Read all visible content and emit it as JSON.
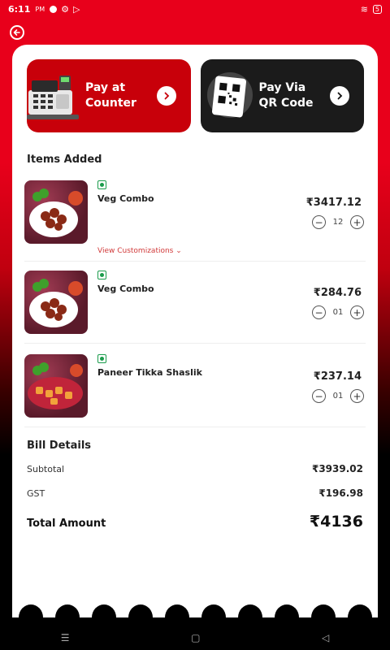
{
  "status_bar": {
    "time": "6:11",
    "ampm": "PM",
    "battery": "5"
  },
  "pay_options": [
    {
      "label_line1": "Pay at",
      "label_line2": "Counter"
    },
    {
      "label_line1": "Pay Via",
      "label_line2": "QR Code"
    }
  ],
  "items_title": "Items Added",
  "items": [
    {
      "name": "Veg Combo",
      "price": "₹3417.12",
      "qty": "12",
      "customize_label": "View Customizations"
    },
    {
      "name": "Veg Combo",
      "price": "₹284.76",
      "qty": "01"
    },
    {
      "name": "Paneer Tikka Shaslik",
      "price": "₹237.14",
      "qty": "01"
    }
  ],
  "bill": {
    "title": "Bill Details",
    "subtotal_label": "Subtotal",
    "subtotal_value": "₹3939.02",
    "gst_label": "GST",
    "gst_value": "₹196.98",
    "total_label": "Total Amount",
    "total_value": "₹4136"
  },
  "colors": {
    "brand_red": "#e8001b",
    "veg_green": "#1a9b4b"
  }
}
